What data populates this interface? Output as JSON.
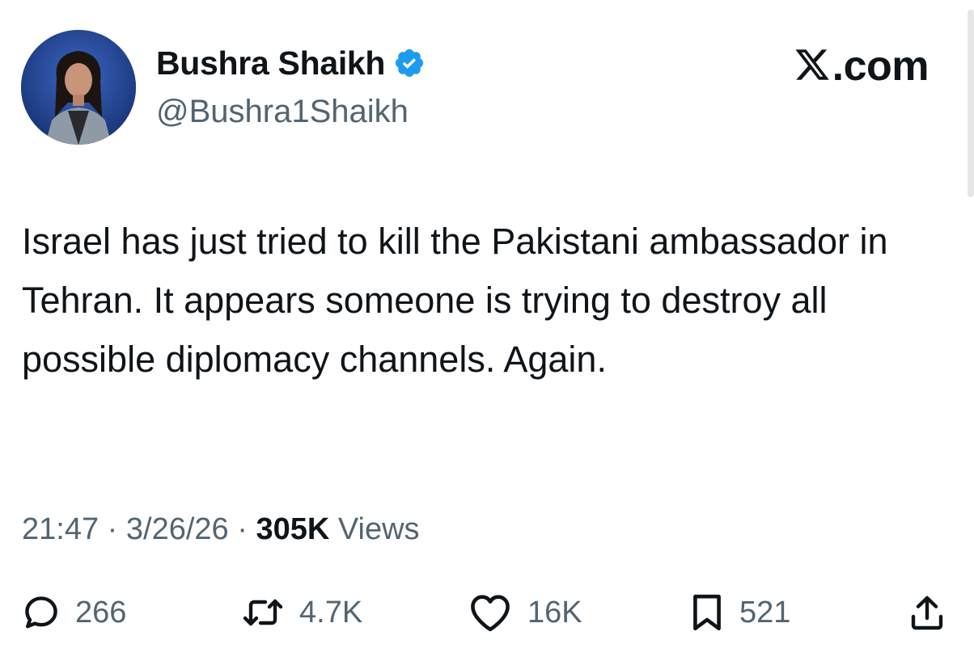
{
  "author": {
    "display_name": "Bushra Shaikh",
    "handle": "@Bushra1Shaikh",
    "verified": true,
    "verified_color": "#1d9bf0"
  },
  "brand": {
    "text": ".com",
    "logo_icon": "x-logo-icon"
  },
  "tweet": {
    "text": "Israel has just tried to kill the Pakistani ambassador in Tehran. It appears someone is trying to destroy all possible diplomacy channels. Again.",
    "time": "21:47",
    "date": "3/26/26",
    "views_count": "305K",
    "views_label": "Views"
  },
  "actions": {
    "replies": {
      "icon": "reply-icon",
      "count": "266"
    },
    "reposts": {
      "icon": "repost-icon",
      "count": "4.7K"
    },
    "likes": {
      "icon": "heart-icon",
      "count": "16K"
    },
    "bookmarks": {
      "icon": "bookmark-icon",
      "count": "521"
    },
    "share": {
      "icon": "share-icon"
    }
  },
  "colors": {
    "text_primary": "#0f1419",
    "text_secondary": "#536471",
    "background": "#ffffff"
  }
}
